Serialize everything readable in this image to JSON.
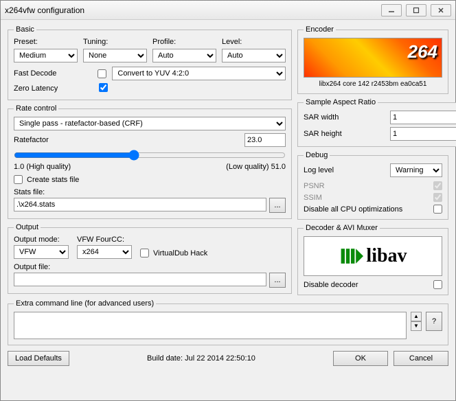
{
  "window": {
    "title": "x264vfw configuration"
  },
  "basic": {
    "legend": "Basic",
    "preset_label": "Preset:",
    "preset_value": "Medium",
    "tuning_label": "Tuning:",
    "tuning_value": "None",
    "profile_label": "Profile:",
    "profile_value": "Auto",
    "level_label": "Level:",
    "level_value": "Auto",
    "fastdecode_label": "Fast Decode",
    "convert_value": "Convert to YUV 4:2:0",
    "zerolatency_label": "Zero Latency"
  },
  "ratecontrol": {
    "legend": "Rate control",
    "mode_value": "Single pass - ratefactor-based (CRF)",
    "ratefactor_label": "Ratefactor",
    "ratefactor_value": "23.0",
    "low_label": "1.0 (High quality)",
    "high_label": "(Low quality) 51.0",
    "create_stats_label": "Create stats file",
    "stats_file_label": "Stats file:",
    "stats_file_value": ".\\x264.stats",
    "browse": "..."
  },
  "output": {
    "legend": "Output",
    "mode_label": "Output mode:",
    "mode_value": "VFW",
    "fourcc_label": "VFW FourCC:",
    "fourcc_value": "x264",
    "vdub_label": "VirtualDub Hack",
    "file_label": "Output file:",
    "file_value": "",
    "browse": "..."
  },
  "encoder": {
    "legend": "Encoder",
    "logo_text": "264",
    "version": "libx264 core 142 r2453bm ea0ca51"
  },
  "sar": {
    "legend": "Sample Aspect Ratio",
    "width_label": "SAR width",
    "width_value": "1",
    "height_label": "SAR height",
    "height_value": "1"
  },
  "debug": {
    "legend": "Debug",
    "loglevel_label": "Log level",
    "loglevel_value": "Warning",
    "psnr_label": "PSNR",
    "ssim_label": "SSIM",
    "disable_cpu_label": "Disable all CPU optimizations"
  },
  "decoder": {
    "legend": "Decoder & AVI Muxer",
    "logo_text": "libav",
    "disable_label": "Disable decoder"
  },
  "extra": {
    "legend": "Extra command line (for advanced users)",
    "help": "?"
  },
  "footer": {
    "defaults": "Load Defaults",
    "build": "Build date: Jul 22 2014 22:50:10",
    "ok": "OK",
    "cancel": "Cancel"
  }
}
